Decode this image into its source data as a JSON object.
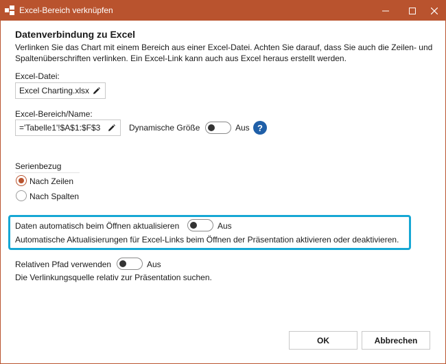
{
  "window": {
    "title": "Excel-Bereich verknüpfen",
    "accent_color": "#b9532e"
  },
  "section": {
    "heading": "Datenverbindung zu Excel",
    "description": "Verlinken Sie das Chart mit einem Bereich aus einer Excel-Datei. Achten Sie darauf, dass Sie auch die Zeilen- und Spaltenüberschriften verlinken. Ein Excel-Link kann auch aus Excel heraus erstellt werden."
  },
  "excel_file": {
    "label": "Excel-Datei:",
    "value": "Excel Charting.xlsx"
  },
  "excel_range": {
    "label": "Excel-Bereich/Name:",
    "value": "='Tabelle1'!$A$1:$F$3",
    "dynamic_size_label": "Dynamische Größe",
    "dynamic_size_state": "Aus",
    "help": "?"
  },
  "series": {
    "label": "Serienbezug",
    "options": [
      {
        "label": "Nach Zeilen",
        "checked": true
      },
      {
        "label": "Nach Spalten",
        "checked": false
      }
    ]
  },
  "auto_update": {
    "label": "Daten automatisch beim Öffnen aktualisieren",
    "state": "Aus",
    "description": "Automatische Aktualisierungen für Excel-Links beim Öffnen der Präsentation aktivieren oder deaktivieren.",
    "highlight_color": "#15a7d4"
  },
  "relative_path": {
    "label": "Relativen Pfad verwenden",
    "state": "Aus",
    "description": "Die Verlinkungsquelle relativ zur Präsentation suchen."
  },
  "buttons": {
    "ok": "OK",
    "cancel": "Abbrechen"
  }
}
